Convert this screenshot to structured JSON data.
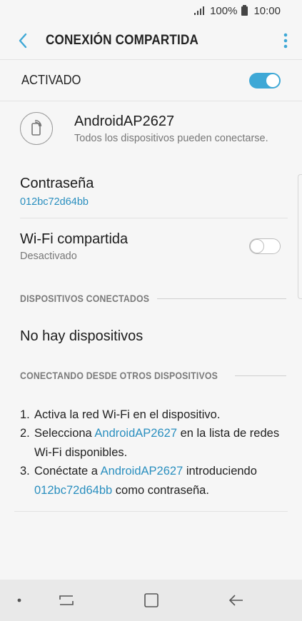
{
  "status_bar": {
    "battery_percent": "100%",
    "time": "10:00"
  },
  "app_bar": {
    "title": "CONEXIÓN COMPARTIDA"
  },
  "master_switch": {
    "label": "ACTIVADO",
    "state": "on"
  },
  "network": {
    "name": "AndroidAP2627",
    "description": "Todos los dispositivos pueden conectarse."
  },
  "password": {
    "label": "Contraseña",
    "value": "012bc72d64bb"
  },
  "wifi_shared": {
    "label": "Wi-Fi compartida",
    "status": "Desactivado",
    "state": "off"
  },
  "connected_devices": {
    "header": "DISPOSITIVOS CONECTADOS",
    "empty_text": "No hay dispositivos"
  },
  "connect_other": {
    "header": "CONECTANDO DESDE OTROS DISPOSITIVOS",
    "steps": [
      {
        "num": "1.",
        "text": "Activa la red Wi-Fi en el dispositivo."
      },
      {
        "num": "2.",
        "pre": "Selecciona ",
        "link": "AndroidAP2627",
        "post": " en la lista de redes Wi-Fi disponibles."
      },
      {
        "num": "3.",
        "pre": "Conéctate a ",
        "link": "AndroidAP2627",
        "mid": " introduciendo ",
        "link2": "012bc72d64bb",
        "post": " como contraseña."
      }
    ]
  },
  "colors": {
    "accent": "#3ea8d6",
    "link": "#2a8fbf",
    "background": "#f6f6f6"
  },
  "icons": [
    "signal-icon",
    "battery-icon",
    "back-arrow-icon",
    "more-vert-icon",
    "hotspot-phone-icon",
    "nav-dot-icon",
    "recent-apps-icon",
    "home-icon",
    "back-icon"
  ]
}
